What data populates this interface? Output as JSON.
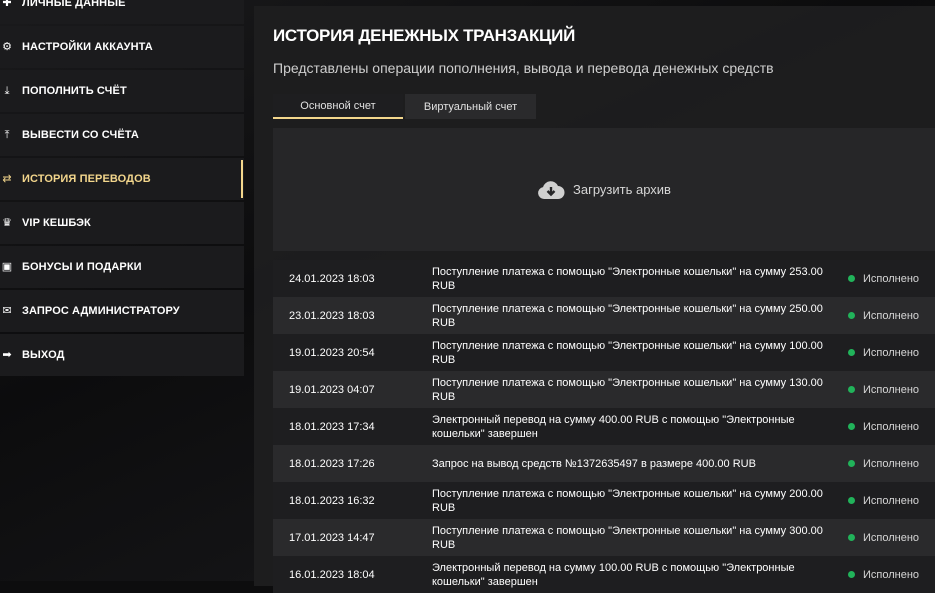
{
  "sidebar": {
    "items": [
      {
        "label": "ЛИЧНЫЕ ДАННЫЕ",
        "icon": "user-plus-icon"
      },
      {
        "label": "НАСТРОЙКИ АККАУНТА",
        "icon": "gears-icon"
      },
      {
        "label": "ПОПОЛНИТЬ СЧЁТ",
        "icon": "download-icon"
      },
      {
        "label": "ВЫВЕСТИ СО СЧЁТА",
        "icon": "upload-icon"
      },
      {
        "label": "ИСТОРИЯ ПЕРЕВОДОВ",
        "icon": "transfer-icon",
        "active": true
      },
      {
        "label": "VIP КЕШБЭК",
        "icon": "crown-icon"
      },
      {
        "label": "БОНУСЫ И ПОДАРКИ",
        "icon": "gift-icon"
      },
      {
        "label": "ЗАПРОС АДМИНИСТРАТОРУ",
        "icon": "envelope-icon"
      },
      {
        "label": "ВЫХОД",
        "icon": "logout-icon"
      }
    ]
  },
  "main": {
    "title": "ИСТОРИЯ ДЕНЕЖНЫХ ТРАНЗАКЦИЙ",
    "subtitle": "Представлены операции пополнения, вывода и перевода денежных средств",
    "tabs": [
      {
        "label": "Основной счет",
        "active": true
      },
      {
        "label": "Виртуальный счет"
      }
    ],
    "archive_label": "Загрузить архив",
    "transactions": [
      {
        "date": "24.01.2023 18:03",
        "desc": "Поступление платежа с помощью \"Электронные кошельки\" на сумму 253.00 RUB",
        "status": "Исполнено"
      },
      {
        "date": "23.01.2023 18:03",
        "desc": "Поступление платежа с помощью \"Электронные кошельки\" на сумму 250.00 RUB",
        "status": "Исполнено"
      },
      {
        "date": "19.01.2023 20:54",
        "desc": "Поступление платежа с помощью \"Электронные кошельки\" на сумму 100.00 RUB",
        "status": "Исполнено"
      },
      {
        "date": "19.01.2023 04:07",
        "desc": "Поступление платежа с помощью \"Электронные кошельки\" на сумму 130.00 RUB",
        "status": "Исполнено"
      },
      {
        "date": "18.01.2023 17:34",
        "desc": "Электронный перевод на сумму 400.00 RUB с помощью \"Электронные кошельки\" завершен",
        "status": "Исполнено"
      },
      {
        "date": "18.01.2023 17:26",
        "desc": "Запрос на вывод средств №1372635497 в размере 400.00 RUB",
        "status": "Исполнено"
      },
      {
        "date": "18.01.2023 16:32",
        "desc": "Поступление платежа с помощью \"Электронные кошельки\" на сумму 200.00 RUB",
        "status": "Исполнено"
      },
      {
        "date": "17.01.2023 14:47",
        "desc": "Поступление платежа с помощью \"Электронные кошельки\" на сумму 300.00 RUB",
        "status": "Исполнено"
      },
      {
        "date": "16.01.2023 18:04",
        "desc": "Электронный перевод на сумму 100.00 RUB с помощью \"Электронные кошельки\" завершен",
        "status": "Исполнено"
      }
    ]
  },
  "colors": {
    "accent": "#f3d68c",
    "success": "#21b35a"
  }
}
